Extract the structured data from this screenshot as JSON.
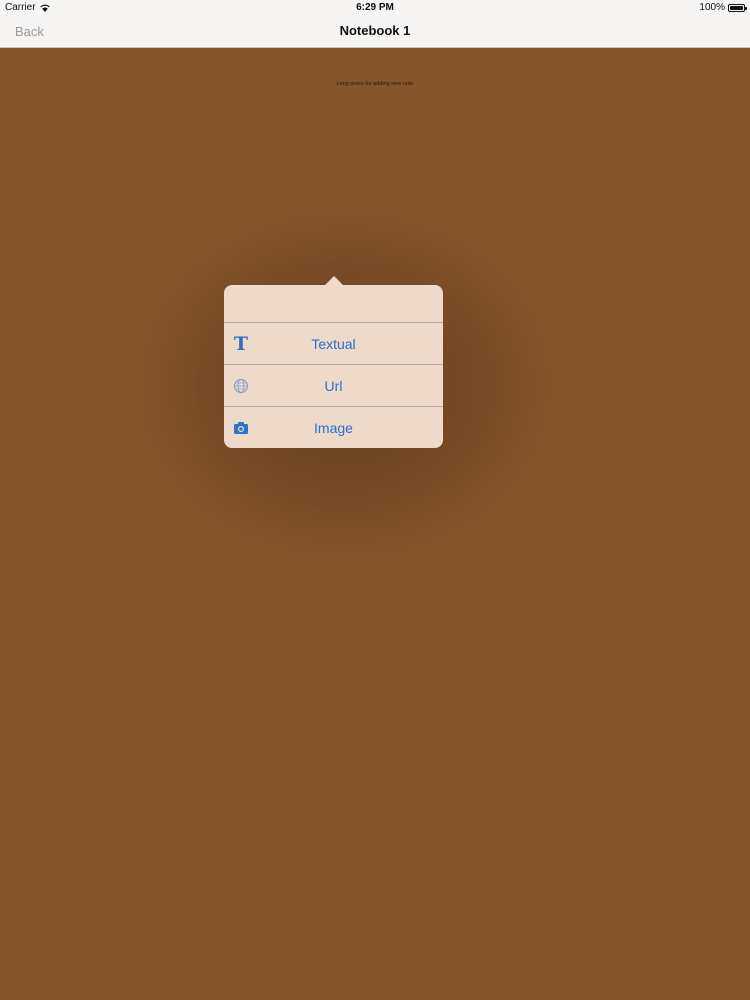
{
  "status_bar": {
    "carrier": "Carrier",
    "time": "6:29 PM",
    "battery": "100%"
  },
  "nav": {
    "back_label": "Back",
    "title": "Notebook 1"
  },
  "canvas": {
    "hint": "Long press for adding new note",
    "background_color": "#87552b"
  },
  "popover": {
    "items": [
      {
        "label": "Textual",
        "icon": "text-icon"
      },
      {
        "label": "Url",
        "icon": "globe-icon"
      },
      {
        "label": "Image",
        "icon": "camera-icon"
      }
    ],
    "accent_color": "#2a6fcf"
  }
}
